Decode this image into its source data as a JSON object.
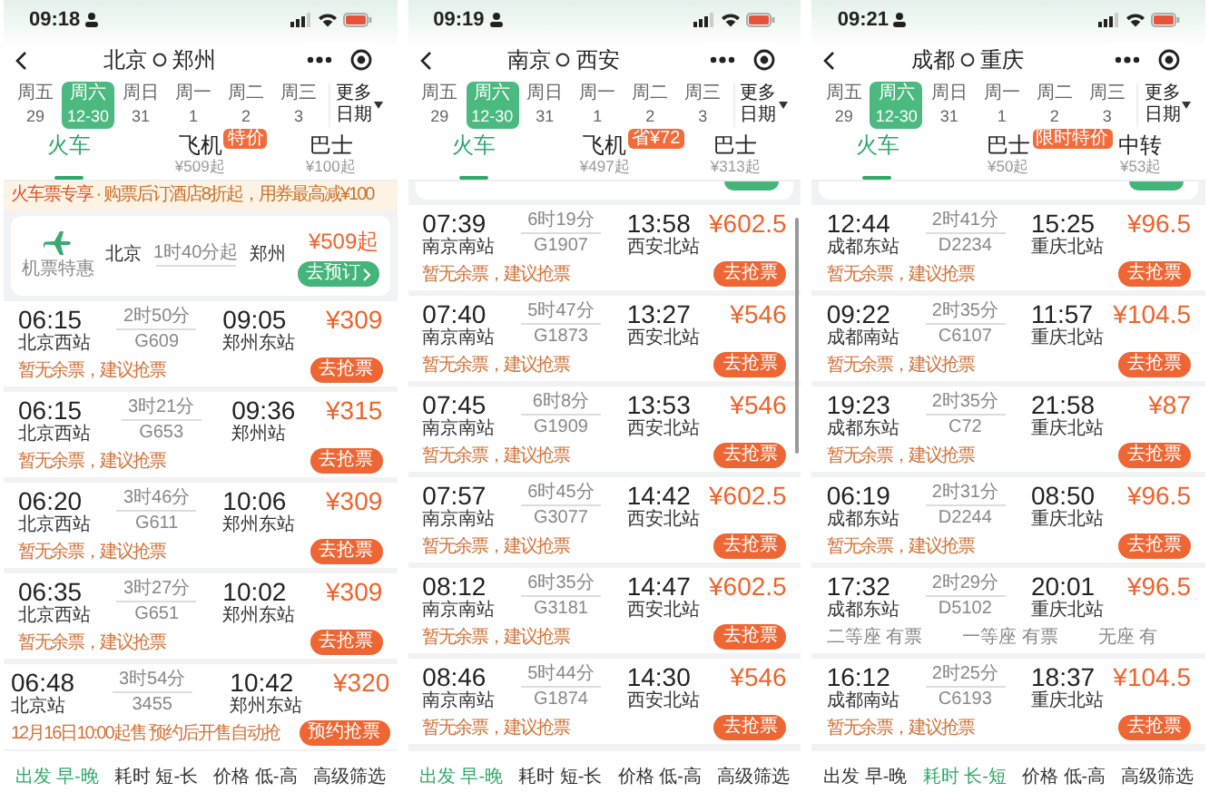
{
  "phones": [
    {
      "status_time": "09:18",
      "title": {
        "from": "北京",
        "to": "郑州"
      },
      "dates": [
        {
          "weekday": "周五",
          "day": "29",
          "selected": false
        },
        {
          "weekday": "周六",
          "day": "12-30",
          "selected": true
        },
        {
          "weekday": "周日",
          "day": "31",
          "selected": false
        },
        {
          "weekday": "周一",
          "day": "1",
          "selected": false
        },
        {
          "weekday": "周二",
          "day": "2",
          "selected": false
        },
        {
          "weekday": "周三",
          "day": "3",
          "selected": false
        }
      ],
      "more_dates": [
        "更多",
        "日期"
      ],
      "modes": [
        {
          "label": "火车",
          "selected": true
        },
        {
          "label": "飞机",
          "sub": "¥509起",
          "badge": "特价",
          "selected": false
        },
        {
          "label": "巴士",
          "sub": "¥100起",
          "selected": false
        }
      ],
      "promo": {
        "title": "火车票专享",
        "text": "· 购票后订酒店8折起，用券最高减¥100"
      },
      "flight_card": {
        "label": "机票特惠",
        "from": "北京",
        "duration": "1时40分起",
        "to": "郑州",
        "price": "¥509起",
        "button": "去预订"
      },
      "trains": [
        {
          "kind": "ticket",
          "depart": "06:15",
          "from": "北京西站",
          "duration": "2时50分",
          "train_no": "G609",
          "arrive": "09:05",
          "to": "郑州东站",
          "price": "¥309",
          "note": "暂无余票，建议抢票",
          "button": "去抢票"
        },
        {
          "kind": "ticket",
          "depart": "06:15",
          "from": "北京西站",
          "duration": "3时21分",
          "train_no": "G653",
          "arrive": "09:36",
          "to": "郑州站",
          "price": "¥315",
          "note": "暂无余票，建议抢票",
          "button": "去抢票"
        },
        {
          "kind": "ticket",
          "depart": "06:20",
          "from": "北京西站",
          "duration": "3时46分",
          "train_no": "G611",
          "arrive": "10:06",
          "to": "郑州东站",
          "price": "¥309",
          "note": "暂无余票，建议抢票",
          "button": "去抢票"
        },
        {
          "kind": "ticket",
          "depart": "06:35",
          "from": "北京西站",
          "duration": "3时27分",
          "train_no": "G651",
          "arrive": "10:02",
          "to": "郑州东站",
          "price": "¥309",
          "note": "暂无余票，建议抢票",
          "button": "去抢票"
        },
        {
          "kind": "ticket",
          "depart": "06:48",
          "from": "北京站",
          "duration": "3时54分",
          "train_no": "3455",
          "arrive": "10:42",
          "to": "郑州东站",
          "price": "¥320",
          "note": "12月16日10:00起售 预约后开售自动抢",
          "button": "预约抢票"
        }
      ],
      "sort": [
        {
          "label": "出发 早-晚",
          "selected": true
        },
        {
          "label": "耗时 短-长",
          "selected": false
        },
        {
          "label": "价格 低-高",
          "selected": false
        },
        {
          "label": "高级筛选",
          "selected": false
        }
      ]
    },
    {
      "status_time": "09:19",
      "title": {
        "from": "南京",
        "to": "西安"
      },
      "dates": [
        {
          "weekday": "周五",
          "day": "29",
          "selected": false
        },
        {
          "weekday": "周六",
          "day": "12-30",
          "selected": true
        },
        {
          "weekday": "周日",
          "day": "31",
          "selected": false
        },
        {
          "weekday": "周一",
          "day": "1",
          "selected": false
        },
        {
          "weekday": "周二",
          "day": "2",
          "selected": false
        },
        {
          "weekday": "周三",
          "day": "3",
          "selected": false
        }
      ],
      "more_dates": [
        "更多",
        "日期"
      ],
      "modes": [
        {
          "label": "火车",
          "selected": true
        },
        {
          "label": "飞机",
          "sub": "¥497起",
          "badge": "省¥72",
          "selected": false
        },
        {
          "label": "巴士",
          "sub": "¥313起",
          "selected": false
        }
      ],
      "list_scrolled": true,
      "scrollbar": true,
      "trains": [
        {
          "kind": "ticket",
          "depart": "07:39",
          "from": "南京南站",
          "duration": "6时19分",
          "train_no": "G1907",
          "arrive": "13:58",
          "to": "西安北站",
          "price": "¥602.5",
          "note": "暂无余票，建议抢票",
          "button": "去抢票"
        },
        {
          "kind": "ticket",
          "depart": "07:40",
          "from": "南京南站",
          "duration": "5时47分",
          "train_no": "G1873",
          "arrive": "13:27",
          "to": "西安北站",
          "price": "¥546",
          "note": "暂无余票，建议抢票",
          "button": "去抢票"
        },
        {
          "kind": "ticket",
          "depart": "07:45",
          "from": "南京南站",
          "duration": "6时8分",
          "train_no": "G1909",
          "arrive": "13:53",
          "to": "西安北站",
          "price": "¥546",
          "note": "暂无余票，建议抢票",
          "button": "去抢票"
        },
        {
          "kind": "ticket",
          "depart": "07:57",
          "from": "南京南站",
          "duration": "6时45分",
          "train_no": "G3077",
          "arrive": "14:42",
          "to": "西安北站",
          "price": "¥602.5",
          "note": "暂无余票，建议抢票",
          "button": "去抢票"
        },
        {
          "kind": "ticket",
          "depart": "08:12",
          "from": "南京南站",
          "duration": "6时35分",
          "train_no": "G3181",
          "arrive": "14:47",
          "to": "西安北站",
          "price": "¥602.5",
          "note": "暂无余票，建议抢票",
          "button": "去抢票"
        },
        {
          "kind": "ticket",
          "depart": "08:46",
          "from": "南京南站",
          "duration": "5时44分",
          "train_no": "G1874",
          "arrive": "14:30",
          "to": "西安北站",
          "price": "¥546",
          "note": "暂无余票，建议抢票",
          "button": "去抢票"
        }
      ],
      "sort": [
        {
          "label": "出发 早-晚",
          "selected": true
        },
        {
          "label": "耗时 短-长",
          "selected": false
        },
        {
          "label": "价格 低-高",
          "selected": false
        },
        {
          "label": "高级筛选",
          "selected": false
        }
      ]
    },
    {
      "status_time": "09:21",
      "title": {
        "from": "成都",
        "to": "重庆"
      },
      "dates": [
        {
          "weekday": "周五",
          "day": "29",
          "selected": false
        },
        {
          "weekday": "周六",
          "day": "12-30",
          "selected": true
        },
        {
          "weekday": "周日",
          "day": "31",
          "selected": false
        },
        {
          "weekday": "周一",
          "day": "1",
          "selected": false
        },
        {
          "weekday": "周二",
          "day": "2",
          "selected": false
        },
        {
          "weekday": "周三",
          "day": "3",
          "selected": false
        }
      ],
      "more_dates": [
        "更多",
        "日期"
      ],
      "modes": [
        {
          "label": "火车",
          "selected": true
        },
        {
          "label": "巴士",
          "sub": "¥50起",
          "badge": "限时特价",
          "selected": false
        },
        {
          "label": "中转",
          "sub": "¥53起",
          "selected": false
        }
      ],
      "list_scrolled": true,
      "trains": [
        {
          "kind": "ticket",
          "depart": "12:44",
          "from": "成都东站",
          "duration": "2时41分",
          "train_no": "D2234",
          "arrive": "15:25",
          "to": "重庆北站",
          "price": "¥96.5",
          "note": "暂无余票，建议抢票",
          "button": "去抢票"
        },
        {
          "kind": "ticket",
          "depart": "09:22",
          "from": "成都南站",
          "duration": "2时35分",
          "train_no": "C6107",
          "arrive": "11:57",
          "to": "重庆北站",
          "price": "¥104.5",
          "note": "暂无余票，建议抢票",
          "button": "去抢票"
        },
        {
          "kind": "ticket",
          "depart": "19:23",
          "from": "成都东站",
          "duration": "2时35分",
          "train_no": "C72",
          "arrive": "21:58",
          "to": "重庆北站",
          "price": "¥87",
          "note": "暂无余票，建议抢票",
          "button": "去抢票"
        },
        {
          "kind": "ticket",
          "depart": "06:19",
          "from": "成都东站",
          "duration": "2时31分",
          "train_no": "D2244",
          "arrive": "08:50",
          "to": "重庆北站",
          "price": "¥96.5",
          "note": "暂无余票，建议抢票",
          "button": "去抢票"
        },
        {
          "kind": "seats",
          "depart": "17:32",
          "from": "成都东站",
          "duration": "2时29分",
          "train_no": "D5102",
          "arrive": "20:01",
          "to": "重庆北站",
          "price": "¥96.5",
          "seats": [
            "二等座 有票",
            "一等座 有票",
            "无座 有"
          ]
        },
        {
          "kind": "ticket",
          "depart": "16:12",
          "from": "成都南站",
          "duration": "2时25分",
          "train_no": "C6193",
          "arrive": "18:37",
          "to": "重庆北站",
          "price": "¥104.5",
          "note": "暂无余票，建议抢票",
          "button": "去抢票"
        }
      ],
      "sort": [
        {
          "label": "出发 早-晚",
          "selected": false
        },
        {
          "label": "耗时 长-短",
          "selected": true
        },
        {
          "label": "价格 低-高",
          "selected": false
        },
        {
          "label": "高级筛选",
          "selected": false
        }
      ]
    }
  ]
}
